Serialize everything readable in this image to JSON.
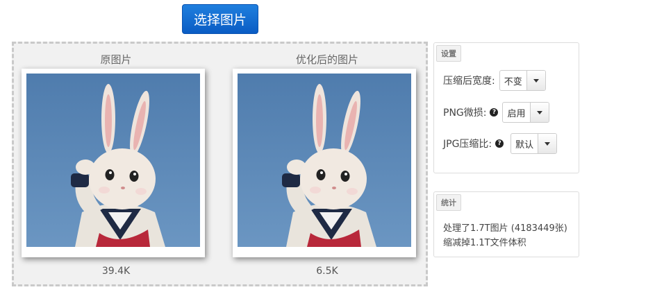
{
  "toolbar": {
    "select_label": "选择图片"
  },
  "compare": {
    "original": {
      "title": "原图片",
      "size": "39.4K"
    },
    "optimized": {
      "title": "优化后的图片",
      "size": "6.5K"
    }
  },
  "settings": {
    "tag": "设置",
    "width": {
      "label": "压缩后宽度:",
      "value": "不变"
    },
    "png": {
      "label": "PNG微损:",
      "value": "启用"
    },
    "jpg": {
      "label": "JPG压缩比:",
      "value": "默认"
    }
  },
  "stats": {
    "tag": "统计",
    "line1": "处理了1.7T图片 (4183449张)",
    "line2": "缩减掉1.1T文件体积"
  },
  "colors": {
    "button": "#1371d6",
    "photo_bg": "#5a86b5"
  },
  "icons": {
    "help": "question-circle-icon",
    "caret": "caret-down-icon"
  }
}
